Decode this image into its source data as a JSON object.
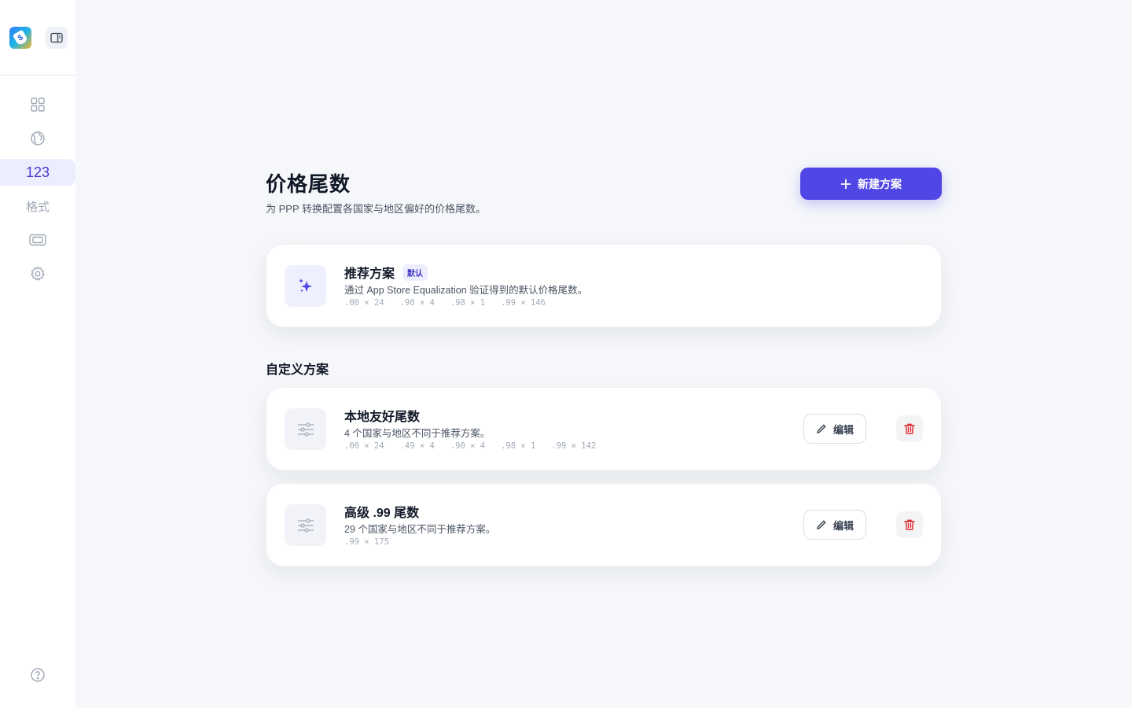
{
  "sidebar": {
    "items": [
      {
        "name": "dashboard",
        "icon": "grid-icon",
        "label": ""
      },
      {
        "name": "globe",
        "icon": "globe-icon",
        "label": ""
      },
      {
        "name": "price-endings",
        "icon": "",
        "label": "123",
        "active": true
      },
      {
        "name": "format",
        "icon": "",
        "label": "格式"
      },
      {
        "name": "display",
        "icon": "screen-icon",
        "label": ""
      },
      {
        "name": "settings",
        "icon": "gear-icon",
        "label": ""
      }
    ]
  },
  "header": {
    "title": "价格尾数",
    "subtitle": "为 PPP 转换配置各国家与地区偏好的价格尾数。",
    "new_button": "新建方案"
  },
  "recommended": {
    "title": "推荐方案",
    "badge": "默认",
    "description": "通过 App Store Equalization 验证得到的默认价格尾数。",
    "endings": [
      ".00 × 24",
      ".90 × 4",
      ".98 × 1",
      ".99 × 146"
    ]
  },
  "custom_section_title": "自定义方案",
  "custom_plans": [
    {
      "title": "本地友好尾数",
      "description": "4 个国家与地区不同于推荐方案。",
      "endings": [
        ".00 × 24",
        ".49 × 4",
        ".90 × 4",
        ".98 × 1",
        ".99 × 142"
      ],
      "edit_label": "编辑"
    },
    {
      "title": "高级 .99 尾数",
      "description": "29 个国家与地区不同于推荐方案。",
      "endings": [
        ".99 × 175"
      ],
      "edit_label": "编辑"
    }
  ],
  "colors": {
    "accent": "#4f46e5",
    "danger": "#dc2626"
  }
}
